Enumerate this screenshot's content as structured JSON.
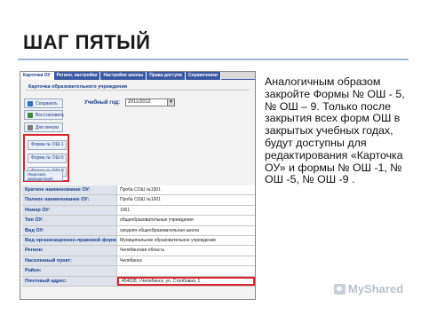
{
  "slide": {
    "title": "ШАГ ПЯТЫЙ",
    "body": "Аналогичным образом закройте Формы № ОШ - 5, № ОШ – 9. Только после закрытия всех форм ОШ в закрытых учебных годах, будут доступны для редактирования «Карточка ОУ» и формы № ОШ -1, № ОШ -5, № ОШ -9 ."
  },
  "screenshot": {
    "tabs": [
      "Карточка ОУ",
      "Регион. настройки",
      "Настройки школы",
      "Права доступа",
      "Справочники"
    ],
    "card_title": "Карточка образовательного учреждения",
    "buttons": {
      "save": "Сохранить",
      "restore": "Восстановить",
      "print": "Для печати",
      "license": "Лицензия, аккредитация"
    },
    "year_label": "Учебный год:",
    "year_value": "2011/2012",
    "forms": [
      "Форма № ОШ-1",
      "Форма № ОШ-5",
      "Форма № ОШ-9"
    ],
    "rows": [
      {
        "label": "Краткое наименование ОУ:",
        "value": "Проба СОШ №1001"
      },
      {
        "label": "Полное наименование ОУ:",
        "value": "Проба СОШ №1001"
      },
      {
        "label": "Номер ОУ:",
        "value": "1001"
      },
      {
        "label": "Тип ОУ:",
        "value": "общеобразовательные учреждения"
      },
      {
        "label": "Вид ОУ:",
        "value": "средняя общеобразовательная школа"
      },
      {
        "label": "Вид организационно-правовой формы ОУ:",
        "value": "Муниципальное образовательное учреждение"
      },
      {
        "label": "Регион:",
        "value": "Челябинская область"
      },
      {
        "label": "Населенный пункт:",
        "value": "Челябинск"
      },
      {
        "label": "Район:",
        "value": ""
      },
      {
        "label": "Почтовый адрес:",
        "value": "454028, г.Челябинск, ул. Столбовая, 1"
      }
    ]
  },
  "watermark": {
    "text": "MyShared"
  },
  "colors": {
    "accent": "#3a59a3",
    "highlight": "#d8262d"
  }
}
